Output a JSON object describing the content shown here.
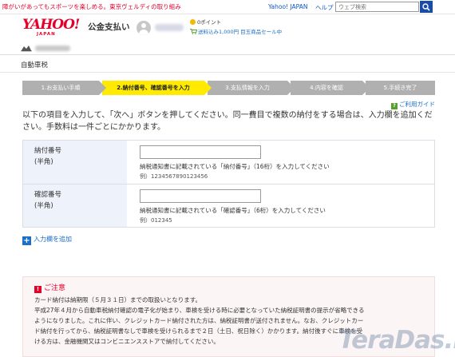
{
  "topbar": {
    "promo": "障がいがあってもスポーツを楽しめる。東京ヴェルディの取り組み",
    "yahoo_japan_link": "Yahoo! JAPAN",
    "help_link": "ヘルプ",
    "search_placeholder": "ウェブ検索"
  },
  "header": {
    "logo_main": "YAHOO!",
    "logo_sub": "JAPAN",
    "service_name": "公金支払い",
    "points": "0ポイント",
    "promo": "送料込み1,000円 目玉商品セール中"
  },
  "breadcrumb": {
    "tax_label": "自動車税"
  },
  "steps": [
    {
      "label": "1.お支払い手順",
      "active": false
    },
    {
      "label": "2.納付番号、確認番号を入力",
      "active": true
    },
    {
      "label": "3.支払情報を入力",
      "active": false
    },
    {
      "label": "4.内容を確認",
      "active": false
    },
    {
      "label": "5.手続き完了",
      "active": false
    }
  ],
  "guide_link": "ご利用ガイド",
  "instruction": "以下の項目を入力して、「次へ」ボタンを押してください。同一費目で複数の納付をする場合は、入力欄を追加ください。手数料は一件ごとにかかります。",
  "form": {
    "payment_number": {
      "label": "納付番号",
      "sublabel": "(半角)",
      "value": "",
      "note": "納税通知書に記載されている「納付番号」（16桁）を入力してください",
      "example": "例）1234567890123456"
    },
    "confirmation_number": {
      "label": "確認番号",
      "sublabel": "(半角)",
      "value": "",
      "note": "納税通知書に記載されている「確認番号」（6桁）を入力してください",
      "example": "例）012345"
    }
  },
  "add_field": "入力欄を追加",
  "caution": {
    "title": "ご注意",
    "lines": [
      "カード納付は納期限（５月３１日）までの取扱いとなります。",
      "平成27年４月から自動車税納付確認の電子化が始まり、車検を受ける時に必要となっていた納税証明書の提示が省略できる",
      "ようになりました。これに伴い、クレジットカード納付された方は、納税証明書が送付されません。なお、クレジットカー",
      "ド納付を行ってから、納税証明書なしで車検を受けられるまで２日（土日、祝日除く）かかります。納付後すぐに車検を受",
      "ける方は、金融機関又はコンビニエンスストアで納付してください。"
    ]
  },
  "watermark": "TeraDas.net",
  "colors": {
    "brand_red": "#e4002b",
    "step_active": "#ffea00",
    "step_inactive": "#b0b0b0",
    "link_blue": "#1a6fc9",
    "label_bg": "#eef2fa",
    "caution_bg": "#fcf5f5"
  }
}
